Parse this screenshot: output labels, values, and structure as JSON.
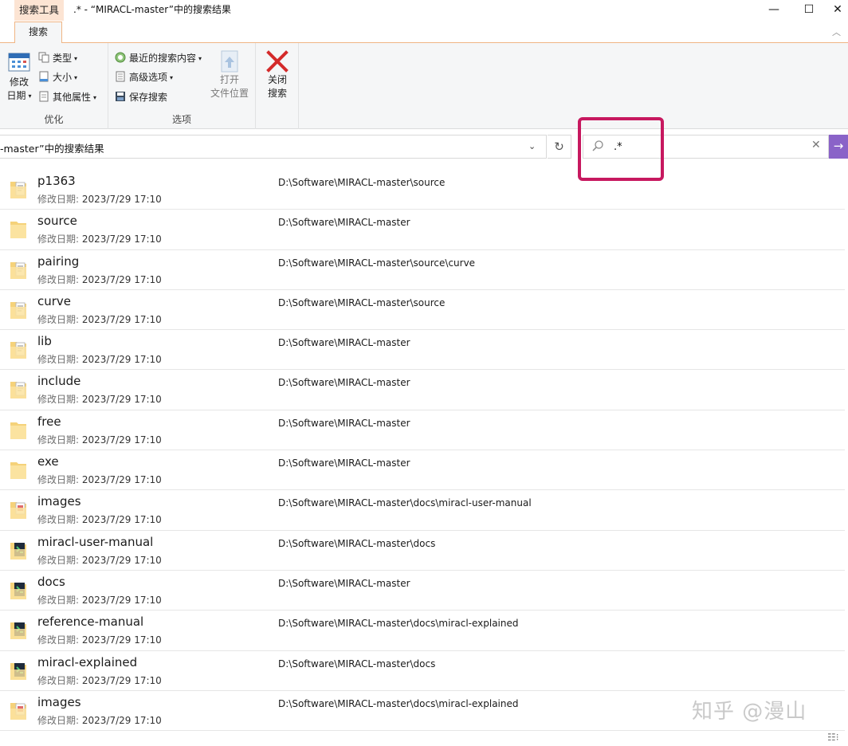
{
  "titlebar": {
    "context_tab": "搜索工具",
    "title": ".* - “MIRACL-master”中的搜索结果",
    "minimize": "—",
    "maximize": "☐",
    "close": "✕"
  },
  "ribbon_tabs": {
    "active": "搜索",
    "collapse": "︿"
  },
  "ribbon": {
    "groups": [
      {
        "label": "优化"
      },
      {
        "label": "选项"
      }
    ],
    "modify_date": {
      "line1": "修改",
      "line2": "日期",
      "arrow": "▾"
    },
    "type": "类型",
    "size": "大小",
    "other_props": "其他属性",
    "recent_searches": "最近的搜索内容",
    "advanced_options": "高级选项",
    "save_search": "保存搜索",
    "open_location": {
      "line1": "打开",
      "line2": "文件位置"
    },
    "close_search": {
      "line1": "关闭",
      "line2": "搜索"
    },
    "dropdown_arrow": "▾"
  },
  "address": {
    "text": "-master”中的搜索结果",
    "dropdown": "⌄",
    "refresh": "↻"
  },
  "search": {
    "value": ".*",
    "clear": "✕",
    "go": "→"
  },
  "date_label": "修改日期: ",
  "results": [
    {
      "name": "p1363",
      "date": "2023/7/29 17:10",
      "path": "D:\\Software\\MIRACL-master\\source",
      "icon": "folder-doc-icon"
    },
    {
      "name": "source",
      "date": "2023/7/29 17:10",
      "path": "D:\\Software\\MIRACL-master",
      "icon": "folder-icon"
    },
    {
      "name": "pairing",
      "date": "2023/7/29 17:10",
      "path": "D:\\Software\\MIRACL-master\\source\\curve",
      "icon": "folder-doc-icon"
    },
    {
      "name": "curve",
      "date": "2023/7/29 17:10",
      "path": "D:\\Software\\MIRACL-master\\source",
      "icon": "folder-doc-icon"
    },
    {
      "name": "lib",
      "date": "2023/7/29 17:10",
      "path": "D:\\Software\\MIRACL-master",
      "icon": "folder-doc-icon"
    },
    {
      "name": "include",
      "date": "2023/7/29 17:10",
      "path": "D:\\Software\\MIRACL-master",
      "icon": "folder-doc-icon"
    },
    {
      "name": "free",
      "date": "2023/7/29 17:10",
      "path": "D:\\Software\\MIRACL-master",
      "icon": "folder-icon"
    },
    {
      "name": "exe",
      "date": "2023/7/29 17:10",
      "path": "D:\\Software\\MIRACL-master",
      "icon": "folder-icon"
    },
    {
      "name": "images",
      "date": "2023/7/29 17:10",
      "path": "D:\\Software\\MIRACL-master\\docs\\miracl-user-manual",
      "icon": "folder-image-icon"
    },
    {
      "name": "miracl-user-manual",
      "date": "2023/7/29 17:10",
      "path": "D:\\Software\\MIRACL-master\\docs",
      "icon": "folder-code-icon"
    },
    {
      "name": "docs",
      "date": "2023/7/29 17:10",
      "path": "D:\\Software\\MIRACL-master",
      "icon": "folder-code-icon"
    },
    {
      "name": "reference-manual",
      "date": "2023/7/29 17:10",
      "path": "D:\\Software\\MIRACL-master\\docs\\miracl-explained",
      "icon": "folder-code-icon"
    },
    {
      "name": "miracl-explained",
      "date": "2023/7/29 17:10",
      "path": "D:\\Software\\MIRACL-master\\docs",
      "icon": "folder-code-icon"
    },
    {
      "name": "images",
      "date": "2023/7/29 17:10",
      "path": "D:\\Software\\MIRACL-master\\docs\\miracl-explained",
      "icon": "folder-image-icon"
    }
  ],
  "watermark": "知乎 @漫山",
  "view_toggle": "☷⁝"
}
